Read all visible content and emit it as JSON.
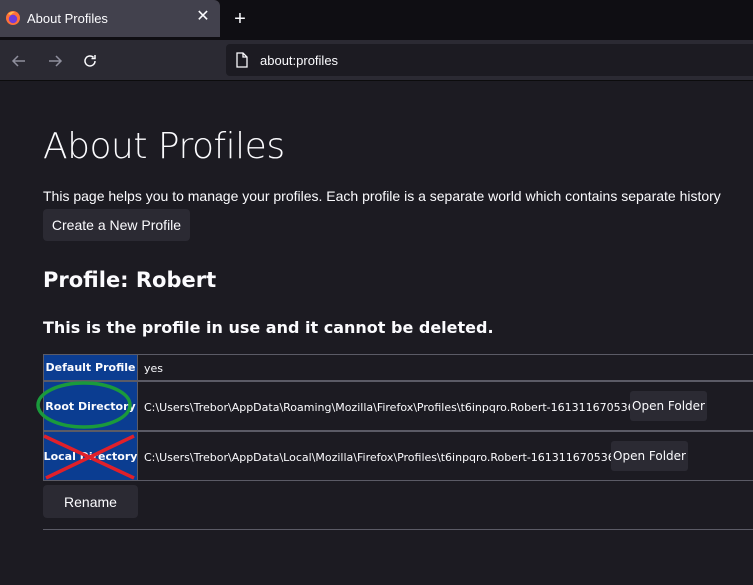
{
  "tab": {
    "title": "About Profiles",
    "favicon": "firefox-icon",
    "close": "✕"
  },
  "new_tab": "+",
  "nav": {
    "back": "back-arrow-icon",
    "forward": "forward-arrow-icon",
    "reload": "reload-icon"
  },
  "urlbar": {
    "url": "about:profiles",
    "icon": "page-icon"
  },
  "page": {
    "title": "About Profiles",
    "intro": "This page helps you to manage your profiles. Each profile is a separate world which contains separate history",
    "create_button": "Create a New Profile",
    "profile_heading": "Profile: Robert",
    "in_use_notice": "This is the profile in use and it cannot be deleted.",
    "rows": [
      {
        "label": "Default Profile",
        "value": "yes",
        "button": ""
      },
      {
        "label": "Root Directory",
        "value": "C:\\Users\\Trebor\\AppData\\Roaming\\Mozilla\\Firefox\\Profiles\\t6inpqro.Robert-1613116705360",
        "button": "Open Folder"
      },
      {
        "label": "Local Directory",
        "value": "C:\\Users\\Trebor\\AppData\\Local\\Mozilla\\Firefox\\Profiles\\t6inpqro.Robert-1613116705360",
        "button": "Open Folder"
      }
    ],
    "rename_button": "Rename"
  },
  "colors": {
    "page_bg": "#1c1b22",
    "label_bg": "#0b3d91",
    "circle_annotation": "#1a9a3c",
    "cross_annotation": "#e0202a"
  }
}
